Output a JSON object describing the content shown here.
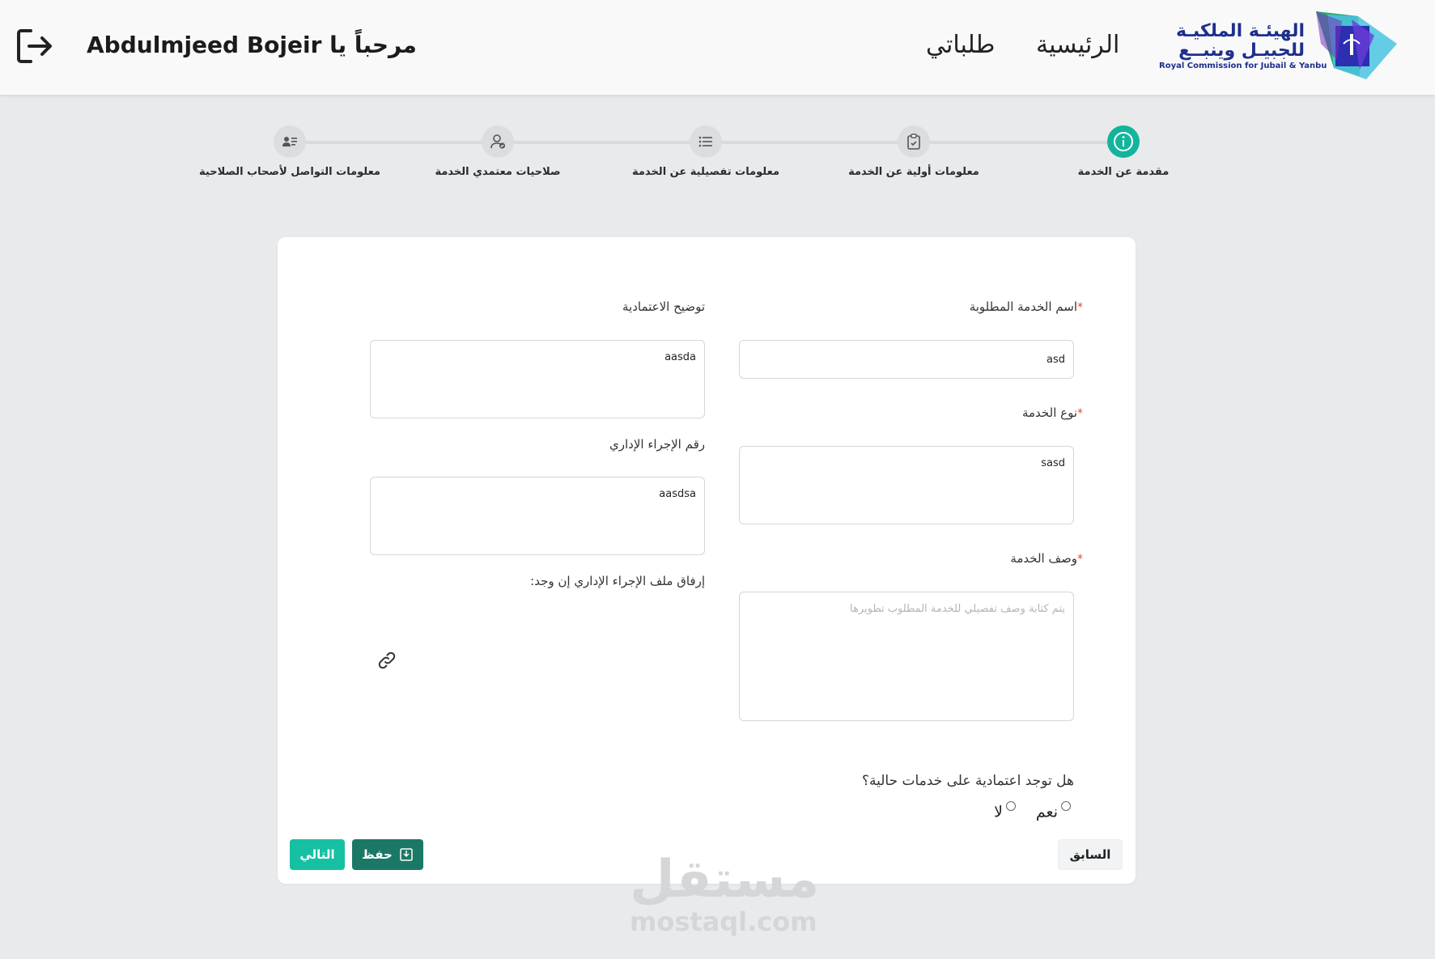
{
  "header": {
    "welcome": "مرحباً يا Abdulmjeed Bojeir",
    "nav_requests": "طلباتي",
    "nav_home": "الرئيسية",
    "logo_ar_line1": "الهيئـة الملكيـة",
    "logo_ar_line2": "للجبيـل وينبــع",
    "logo_en": "Royal Commission for Jubail & Yanbu"
  },
  "steps": [
    {
      "label": "مقدمة عن الخدمة",
      "icon": "info-icon",
      "active": true
    },
    {
      "label": "معلومات أولية عن الخدمة",
      "icon": "clipboard-icon",
      "active": false
    },
    {
      "label": "معلومات تفصيلية عن الخدمة",
      "icon": "list-icon",
      "active": false
    },
    {
      "label": "صلاحيات معتمدي الخدمة",
      "icon": "user-check-icon",
      "active": false
    },
    {
      "label": "معلومات التواصل لأصحاب الصلاحية",
      "icon": "contact-card-icon",
      "active": false
    }
  ],
  "form": {
    "service_name": {
      "label": "اسم الخدمة المطلوبة",
      "required_mark": "*",
      "value": "asd"
    },
    "service_type": {
      "label": "نوع الخدمة",
      "required_mark": "*",
      "value": "sasd"
    },
    "service_desc": {
      "label": "وصف الخدمة",
      "required_mark": "*",
      "value": "",
      "placeholder": "يتم كتابة وصف تفصيلي للخدمة المطلوب تطويرها"
    },
    "dependency_note": {
      "label": "توضيح الاعتمادية",
      "value": "aasda"
    },
    "admin_proc_no": {
      "label": "رقم الإجراء الإداري",
      "value": "aasdsa"
    },
    "attach": {
      "label": "إرفاق ملف الإجراء الإداري إن وجد:",
      "icon": "link-icon"
    },
    "question": {
      "label": "هل توجد اعتمادية على خدمات حالية؟",
      "options": [
        "نعم",
        "لا"
      ],
      "selected": null
    }
  },
  "buttons": {
    "prev": "السابق",
    "save": "حفظ",
    "next": "التالي"
  },
  "watermark": {
    "ar": "مستقل",
    "en": "mostaql.com"
  },
  "colors": {
    "accent": "#12b59b",
    "save": "#1c7866",
    "next": "#16c1a3",
    "required": "#e04545"
  }
}
